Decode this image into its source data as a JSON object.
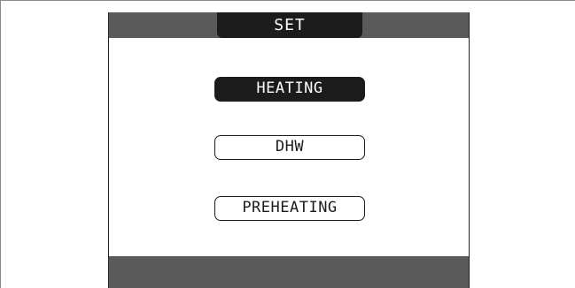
{
  "header": {
    "title": "SET"
  },
  "menu": {
    "items": [
      {
        "label": "HEATING",
        "selected": true
      },
      {
        "label": "DHW",
        "selected": false
      },
      {
        "label": "PREHEATING",
        "selected": false
      }
    ]
  },
  "colors": {
    "bar": "#5a5a5a",
    "selected_bg": "#1c1c1c",
    "text": "#1c1c1c",
    "background": "#ffffff"
  }
}
